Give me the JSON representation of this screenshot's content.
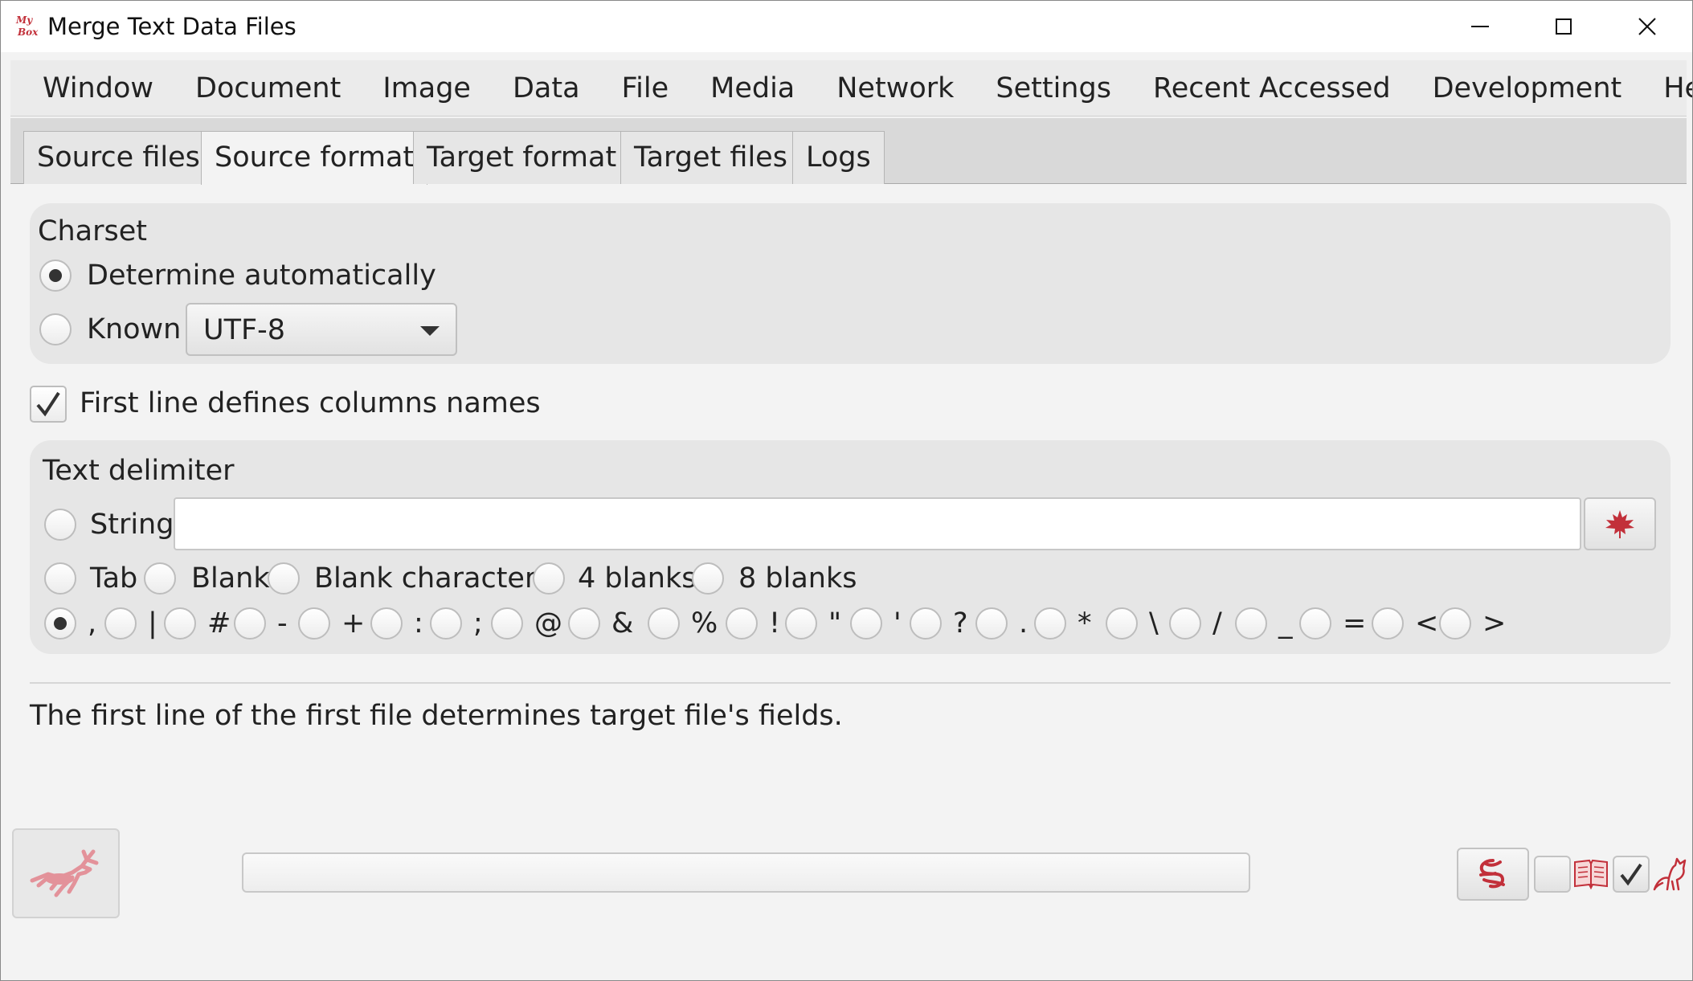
{
  "window": {
    "title": "Merge Text Data Files",
    "logo_text": "My Box"
  },
  "menu": [
    "Window",
    "Document",
    "Image",
    "Data",
    "File",
    "Media",
    "Network",
    "Settings",
    "Recent Accessed",
    "Development",
    "Help"
  ],
  "tabs": [
    {
      "label": "Source files",
      "active": false
    },
    {
      "label": "Source format",
      "active": true
    },
    {
      "label": "Target format",
      "active": false
    },
    {
      "label": "Target files",
      "active": false
    },
    {
      "label": "Logs",
      "active": false
    }
  ],
  "charset": {
    "title": "Charset",
    "auto_label": "Determine automatically",
    "known_label": "Known",
    "selected_option": "auto",
    "known_value": "UTF-8"
  },
  "first_line": {
    "label": "First line defines columns names",
    "checked": true
  },
  "delimiter": {
    "title": "Text delimiter",
    "string_label": "String",
    "string_value": "",
    "named_options": [
      "Tab",
      "Blank",
      "Blank characters",
      "4 blanks",
      "8 blanks"
    ],
    "symbol_options": [
      ",",
      "|",
      "#",
      "-",
      "+",
      ":",
      ";",
      "@",
      "&",
      "%",
      "!",
      "\"",
      "'",
      "?",
      ".",
      "*",
      "\\",
      "/",
      "_",
      "=",
      "<",
      ">"
    ],
    "selected": ","
  },
  "info_text": "The first line of the first file determines target file's fields.",
  "progress": {
    "percent": 0
  },
  "colors": {
    "accent_red": "#c2303a",
    "background": "#f3f3f3",
    "group_bg": "#e6e6e6"
  },
  "icons": {
    "string_button": "maple-leaf-icon",
    "start_button": "deer-icon",
    "bottom": [
      "swirl-icon",
      "book-icon",
      "checkmark-icon",
      "cat-icon"
    ]
  }
}
